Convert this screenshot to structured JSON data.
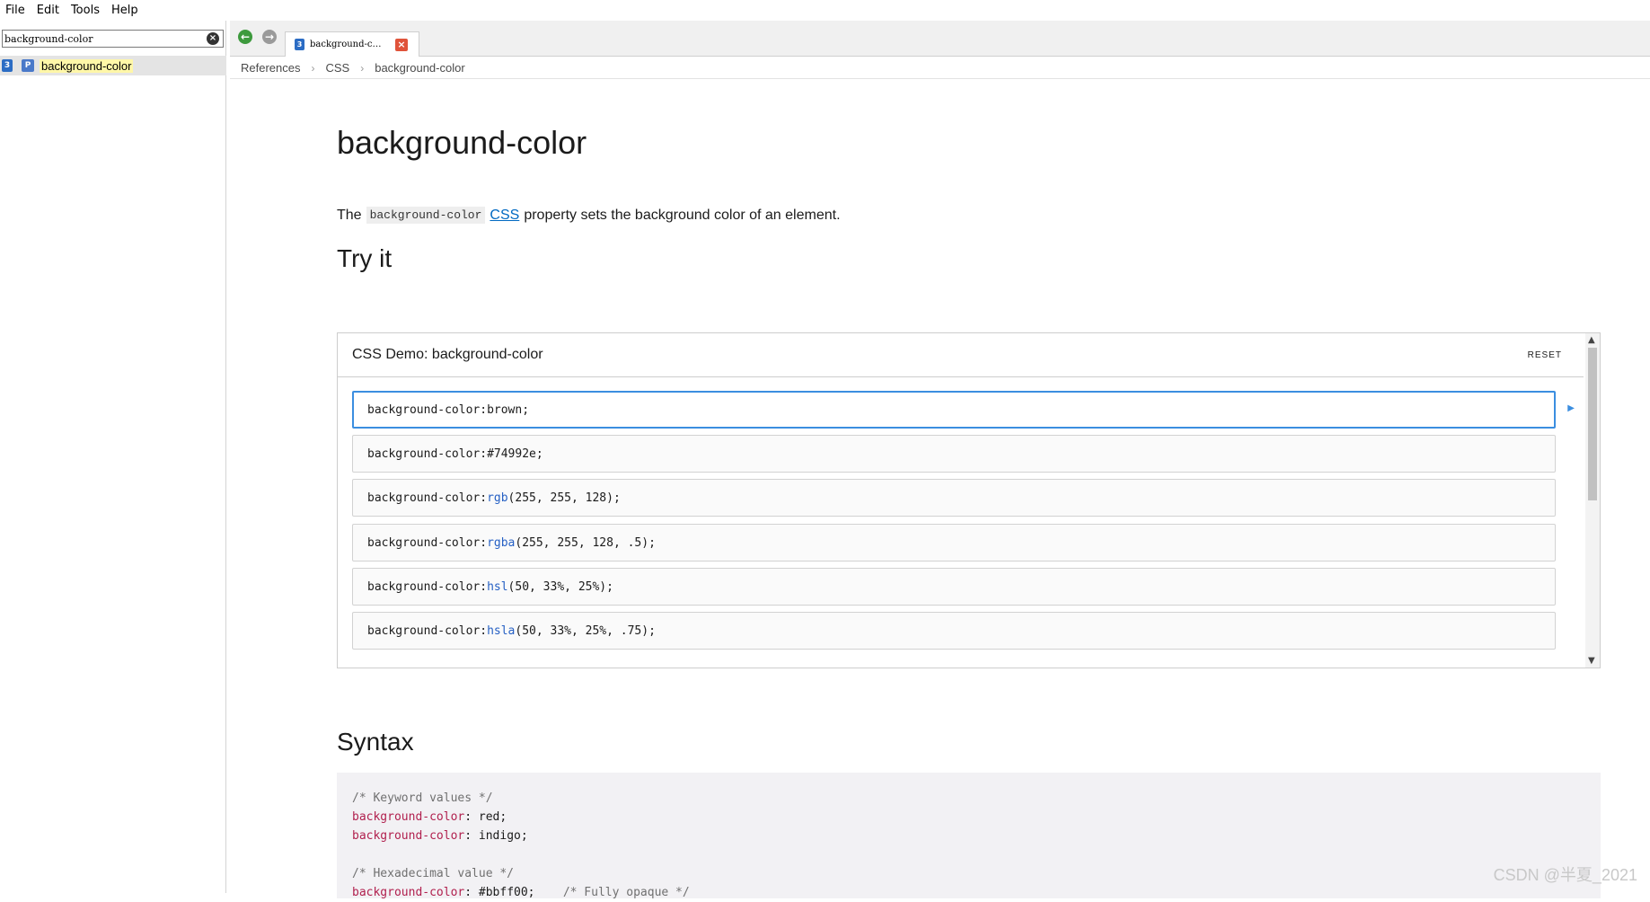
{
  "menu": [
    "File",
    "Edit",
    "Tools",
    "Help"
  ],
  "search": {
    "value": "background-color"
  },
  "results": [
    {
      "badge_css": "3",
      "badge_prop": "P",
      "label": "background-color"
    }
  ],
  "tab": {
    "label": "background-c…"
  },
  "breadcrumb": [
    "References",
    "CSS",
    "background-color"
  ],
  "page": {
    "title": "background-color",
    "intro_the": "The",
    "intro_code": "background-color",
    "intro_link": "CSS",
    "intro_rest": "property sets the background color of an element.",
    "try_it": "Try it",
    "syntax": "Syntax"
  },
  "demo": {
    "title": "CSS Demo: background-color",
    "reset_label": "RESET",
    "options": [
      {
        "prop": "background-color: ",
        "fn": "",
        "args": "brown;"
      },
      {
        "prop": "background-color: ",
        "fn": "",
        "args": "#74992e;"
      },
      {
        "prop": "background-color: ",
        "fn": "rgb",
        "args": "(255, 255, 128);"
      },
      {
        "prop": "background-color: ",
        "fn": "rgba",
        "args": "(255, 255, 128, .5);"
      },
      {
        "prop": "background-color: ",
        "fn": "hsl",
        "args": "(50, 33%, 25%);"
      },
      {
        "prop": "background-color: ",
        "fn": "hsla",
        "args": "(50, 33%, 25%, .75);"
      }
    ],
    "selected_index": 0
  },
  "syntax_lines": [
    {
      "comment": "/* Keyword values */"
    },
    {
      "prop": "background-color",
      "rest": ": red;"
    },
    {
      "prop": "background-color",
      "rest": ": indigo;"
    },
    {
      "blank": true
    },
    {
      "comment": "/* Hexadecimal value */"
    },
    {
      "prop": "background-color",
      "rest": ": #bbff00;",
      "tail": "    /* Fully opaque */"
    }
  ],
  "watermark": "CSDN @半夏_2021",
  "colors": {
    "accent": "#3b8ee0",
    "link": "#0069c2",
    "code_prop": "#b1204e"
  }
}
